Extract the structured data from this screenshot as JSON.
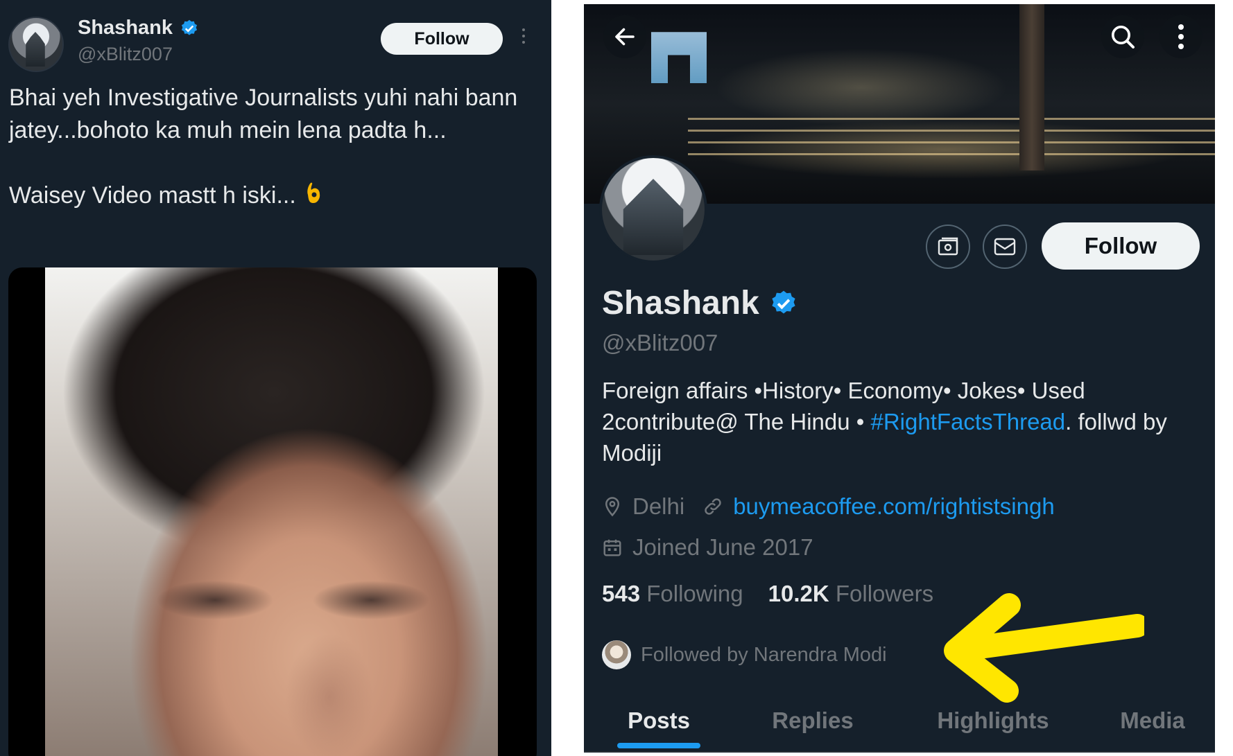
{
  "tweet": {
    "author_name": "Shashank",
    "author_handle": "@xBlitz007",
    "follow_label": "Follow",
    "text_line1": "Bhai yeh Investigative Journalists yuhi nahi bann jatey...bohoto ka muh mein lena padta h...",
    "text_line2": "Waisey Video mastt h iski...",
    "emoji": "ok-hand-emoji"
  },
  "profile": {
    "name": "Shashank",
    "handle": "@xBlitz007",
    "follow_label": "Follow",
    "bio_part1": "Foreign affairs •History• Economy• Jokes• Used 2contribute@ The Hindu • ",
    "bio_hashtag": "#RightFactsThread",
    "bio_part2": ". follwd by Modiji",
    "location": "Delhi",
    "website": "buymeacoffee.com/rightistsingh",
    "joined": "Joined June 2017",
    "following_count": "543",
    "following_label": "Following",
    "followers_count": "10.2K",
    "followers_label": "Followers",
    "followed_by": "Followed by Narendra Modi",
    "tabs": [
      {
        "label": "Posts",
        "active": true
      },
      {
        "label": "Replies",
        "active": false
      },
      {
        "label": "Highlights",
        "active": false
      },
      {
        "label": "Media",
        "active": false
      }
    ]
  },
  "colors": {
    "background": "#15202b",
    "accent": "#1d9bf0",
    "annotation_arrow": "#ffe600"
  },
  "icons": [
    "verified-badge-icon",
    "more-icon",
    "back-arrow-icon",
    "search-icon",
    "subscriptions-icon",
    "message-icon",
    "location-icon",
    "link-icon",
    "calendar-icon"
  ]
}
